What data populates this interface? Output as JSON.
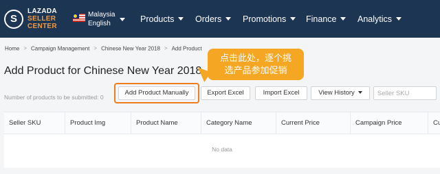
{
  "brand": {
    "line1": "LAZADA",
    "line2": "SELLER",
    "line3": "CENTER",
    "mark": "S"
  },
  "locale": {
    "country": "Malaysia",
    "language": "English"
  },
  "nav": {
    "items": [
      {
        "label": "Products"
      },
      {
        "label": "Orders"
      },
      {
        "label": "Promotions"
      },
      {
        "label": "Finance"
      },
      {
        "label": "Analytics"
      }
    ]
  },
  "breadcrumb": [
    "Home",
    "Campaign Management",
    "Chinese New Year 2018",
    "Add Product"
  ],
  "page": {
    "title": "Add Product for Chinese New Year 2018"
  },
  "callout": {
    "line1": "点击此处，逐个挑",
    "line2": "选产品参加促销"
  },
  "toolbar": {
    "count_label": "Number of products to be submitted: 0",
    "add_manual": "Add Product Manually",
    "export": "Export Excel",
    "import": "Import Excel",
    "history": "View History",
    "sku_placeholder": "Seller SKU"
  },
  "table": {
    "columns": [
      "Seller SKU",
      "Product Img",
      "Product Name",
      "Category Name",
      "Current Price",
      "Campaign Price",
      "Cu"
    ],
    "empty_text": "No data"
  },
  "colors": {
    "topbar": "#1c3552",
    "accent": "#f39a3f",
    "callout": "#f5a623",
    "highlight": "#f07c1c"
  }
}
